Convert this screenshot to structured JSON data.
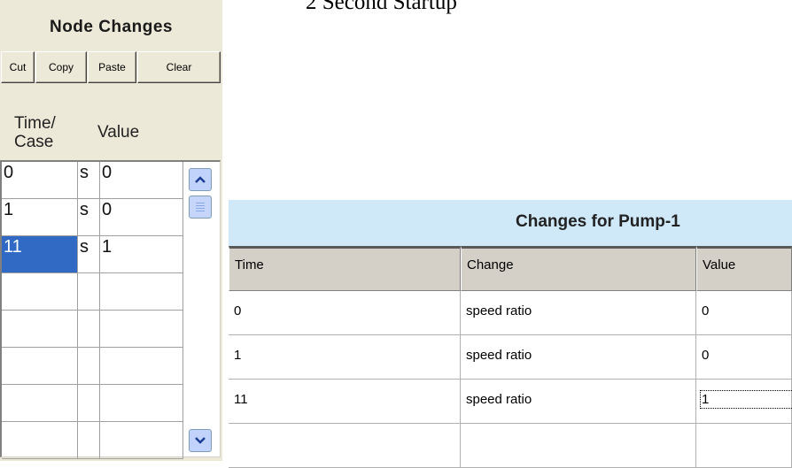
{
  "page_title": "2 Second Startup",
  "node_panel": {
    "title": "Node Changes",
    "buttons": {
      "cut": "Cut",
      "copy": "Copy",
      "paste": "Paste",
      "clear": "Clear"
    },
    "headers": {
      "time_case": "Time/\nCase",
      "value": "Value"
    },
    "rows": [
      {
        "time": "0",
        "unit": "s",
        "value": "0",
        "selected": false
      },
      {
        "time": "1",
        "unit": "s",
        "value": "0",
        "selected": false
      },
      {
        "time": "11",
        "unit": "s",
        "value": "1",
        "selected": true
      },
      {
        "time": "",
        "unit": "",
        "value": "",
        "selected": false
      },
      {
        "time": "",
        "unit": "",
        "value": "",
        "selected": false
      },
      {
        "time": "",
        "unit": "",
        "value": "",
        "selected": false
      },
      {
        "time": "",
        "unit": "",
        "value": "",
        "selected": false
      },
      {
        "time": "",
        "unit": "",
        "value": "",
        "selected": false
      }
    ]
  },
  "changes_table": {
    "title": "Changes for  Pump-1",
    "columns": {
      "time": "Time",
      "change": "Change",
      "value": "Value"
    },
    "rows": [
      {
        "time": "0",
        "change": "speed ratio",
        "value": "0"
      },
      {
        "time": "1",
        "change": "speed ratio",
        "value": "0"
      },
      {
        "time": "11",
        "change": "speed ratio",
        "value": "1"
      },
      {
        "time": "",
        "change": "",
        "value": ""
      }
    ]
  },
  "colors": {
    "selection": "#316ac5",
    "panel_bg": "#ece9d8",
    "title_bar": "#cfe9f9"
  }
}
